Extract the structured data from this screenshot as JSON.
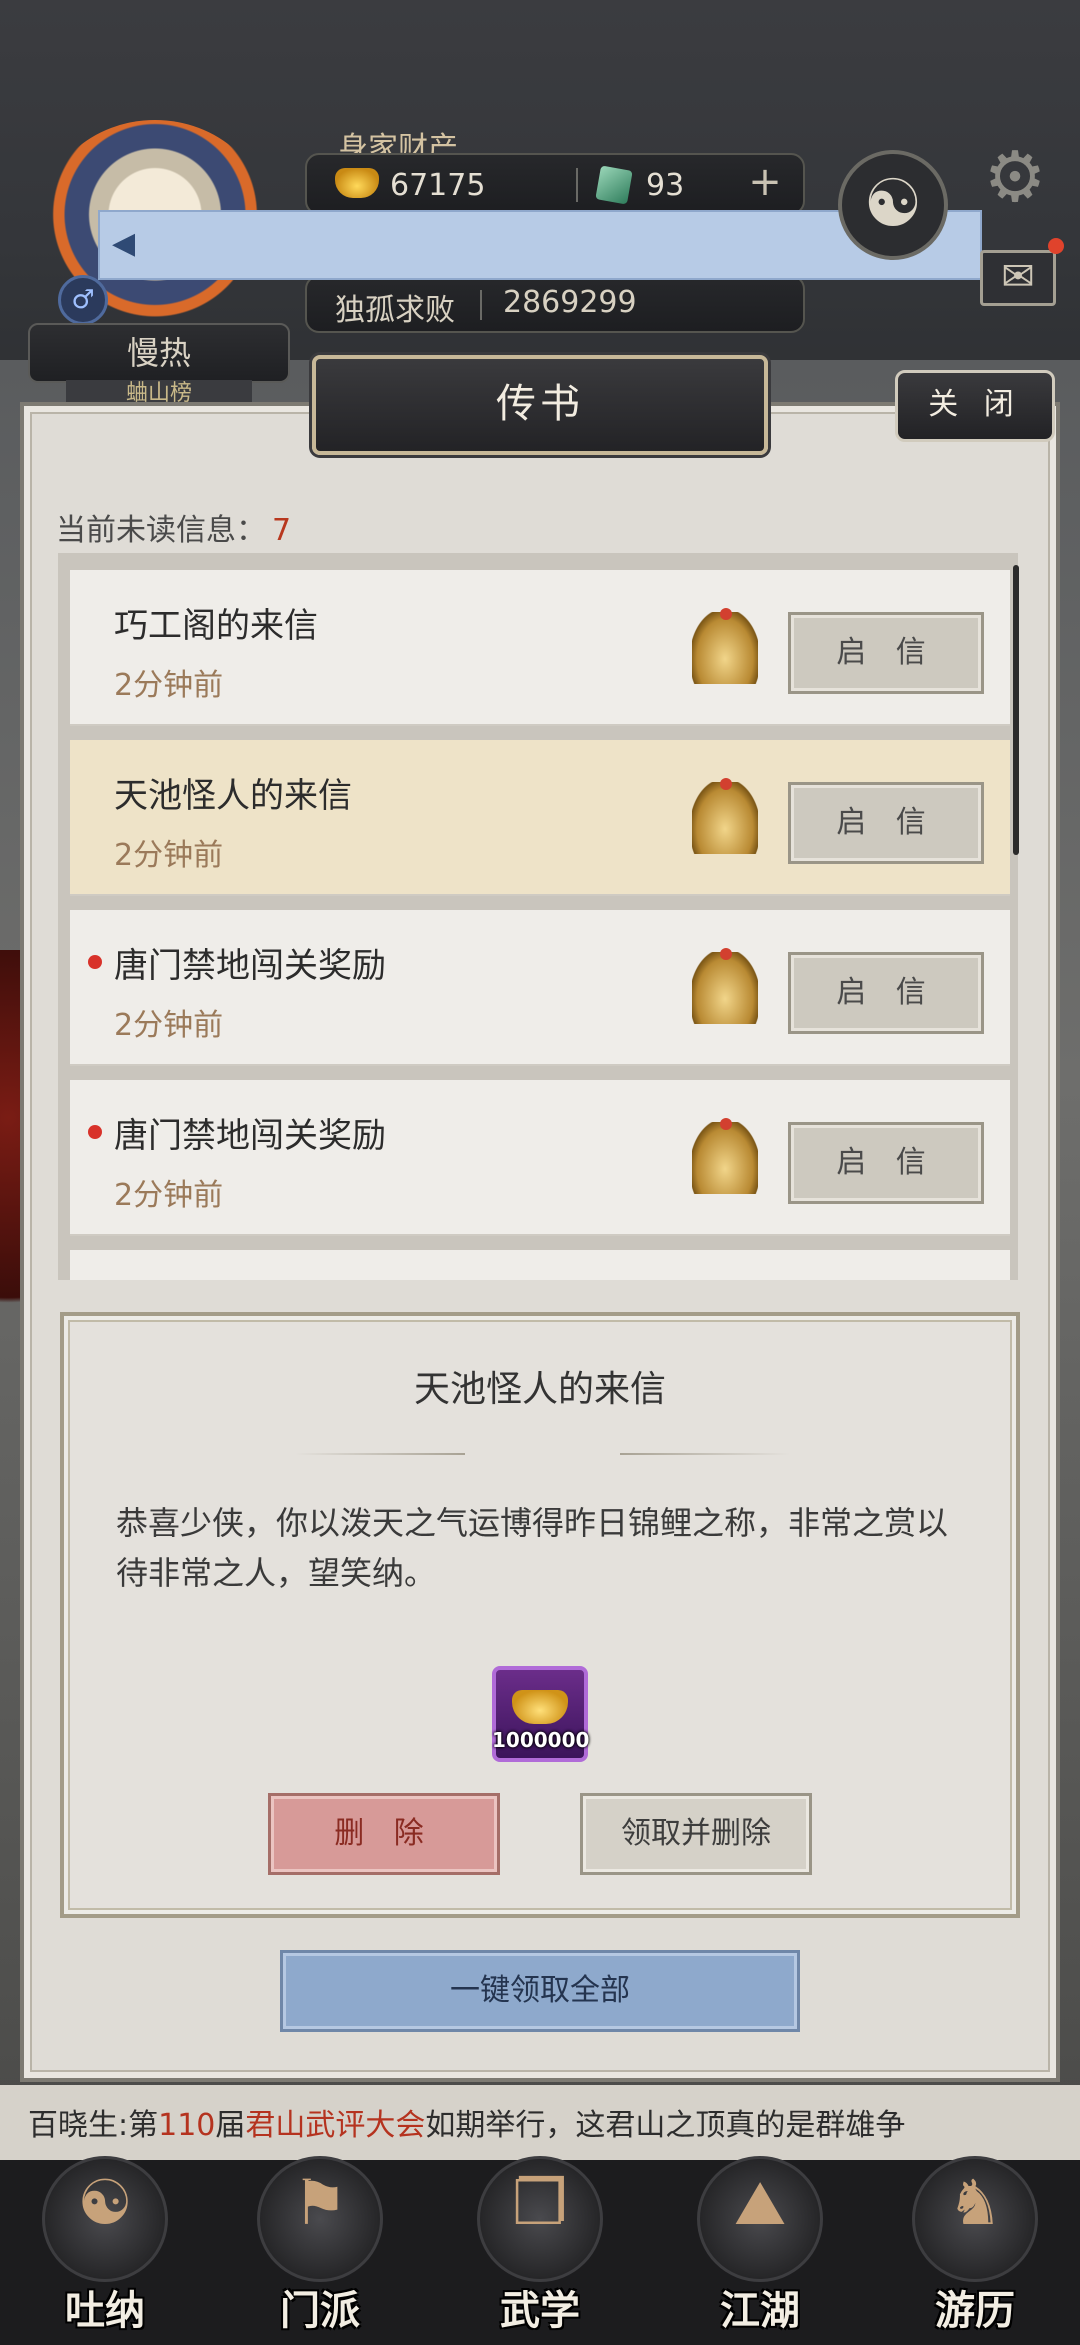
{
  "hud": {
    "wealth_label": "身家财产",
    "gold": "67175",
    "jade": "93",
    "plus": "+",
    "player_name": "独孤求败",
    "power": "2869299",
    "nickname": "慢热",
    "rank_tag": "蛐山榜",
    "gender_symbol": "♂",
    "taiji_symbol": "☯",
    "gear_symbol": "⚙",
    "mail_symbol": "✉",
    "megaphone_symbol": "◀"
  },
  "dialog": {
    "title": "传书",
    "close_label": "关 闭",
    "unread_label": "当前未读信息：",
    "unread_count": "7"
  },
  "mail_list": [
    {
      "title": "巧工阁的来信",
      "time": "2分钟前",
      "unread": false,
      "active": false,
      "button": "启 信"
    },
    {
      "title": "天池怪人的来信",
      "time": "2分钟前",
      "unread": false,
      "active": true,
      "button": "启 信"
    },
    {
      "title": "唐门禁地闯关奖励",
      "time": "2分钟前",
      "unread": true,
      "active": false,
      "button": "启 信"
    },
    {
      "title": "唐门禁地闯关奖励",
      "time": "2分钟前",
      "unread": true,
      "active": false,
      "button": "启 信"
    }
  ],
  "detail": {
    "title": "天池怪人的来信",
    "body": "恭喜少侠，你以泼天之气运博得昨日锦鲤之称，非常之赏以待非常之人，望笑纳。",
    "reward_quantity": "1000000",
    "delete_label": "删 除",
    "claim_delete_label": "领取并删除",
    "claim_all_label": "一键领取全部"
  },
  "chat": {
    "prefix": "百晓生:第",
    "number": "110",
    "middle": "届",
    "event": "君山武评大会",
    "suffix": "如期举行，这君山之顶真的是群雄争"
  },
  "nav": [
    {
      "label": "吐纳",
      "glyph": "☯"
    },
    {
      "label": "门派",
      "glyph": "⚑"
    },
    {
      "label": "武学",
      "glyph": "❐"
    },
    {
      "label": "江湖",
      "glyph": "⛰"
    },
    {
      "label": "游历",
      "glyph": "♞"
    }
  ]
}
